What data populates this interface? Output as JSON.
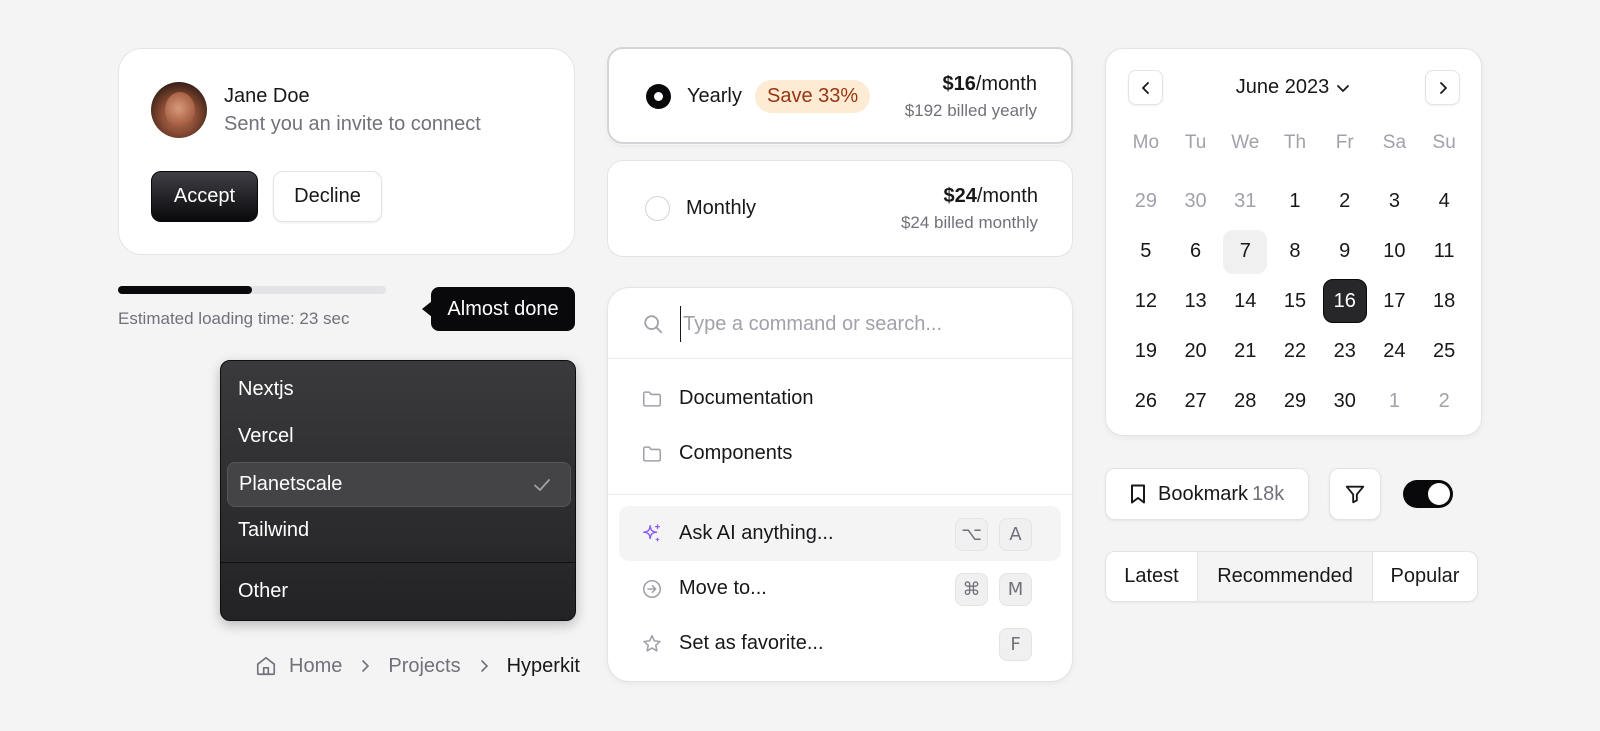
{
  "invite": {
    "name": "Jane Doe",
    "message": "Sent you an invite to connect",
    "accept_label": "Accept",
    "decline_label": "Decline"
  },
  "progress": {
    "value_percent": 50,
    "estimate_text": "Estimated loading time: 23 sec",
    "tooltip": "Almost done"
  },
  "dropdown": {
    "items": [
      "Nextjs",
      "Vercel",
      "Planetscale",
      "Tailwind"
    ],
    "selected": "Planetscale",
    "footer_item": "Other"
  },
  "breadcrumb": {
    "items": [
      "Home",
      "Projects"
    ],
    "current": "Hyperkit"
  },
  "pricing": {
    "yearly": {
      "label": "Yearly",
      "badge": "Save 33%",
      "price": "$16",
      "per": "/month",
      "billed": "$192 billed yearly",
      "selected": true
    },
    "monthly": {
      "label": "Monthly",
      "price": "$24",
      "per": "/month",
      "billed": "$24 billed monthly",
      "selected": false
    }
  },
  "command": {
    "placeholder": "Type a command or search...",
    "folders": [
      {
        "label": "Documentation",
        "icon": "folder-icon"
      },
      {
        "label": "Components",
        "icon": "folder-icon"
      }
    ],
    "actions": [
      {
        "label": "Ask AI anything...",
        "icon": "sparkles-icon",
        "keys": [
          "⌥",
          "A"
        ],
        "active": true
      },
      {
        "label": "Move to...",
        "icon": "arrow-circle-right-icon",
        "keys": [
          "⌘",
          "M"
        ],
        "active": false
      },
      {
        "label": "Set as favorite...",
        "icon": "star-icon",
        "keys": [
          "F"
        ],
        "active": false
      }
    ]
  },
  "calendar": {
    "title": "June 2023",
    "weekdays": [
      "Mo",
      "Tu",
      "We",
      "Th",
      "Fr",
      "Sa",
      "Su"
    ],
    "weeks": [
      [
        "29",
        "30",
        "31",
        "1",
        "2",
        "3",
        "4"
      ],
      [
        "5",
        "6",
        "7",
        "8",
        "9",
        "10",
        "11"
      ],
      [
        "12",
        "13",
        "14",
        "15",
        "16",
        "17",
        "18"
      ],
      [
        "19",
        "20",
        "21",
        "22",
        "23",
        "24",
        "25"
      ],
      [
        "26",
        "27",
        "28",
        "29",
        "30",
        "1",
        "2"
      ]
    ],
    "today": "7",
    "selected": "16"
  },
  "bookmark": {
    "label": "Bookmark",
    "count": "18k"
  },
  "toggle": {
    "on": true
  },
  "segmented": {
    "options": [
      "Latest",
      "Recommended",
      "Popular"
    ],
    "active": "Recommended"
  },
  "colors": {
    "accent": "#09090b",
    "badge_bg": "#fdebd3",
    "badge_text": "#9a3412",
    "ai_sparkle": "#8b5cf6"
  }
}
